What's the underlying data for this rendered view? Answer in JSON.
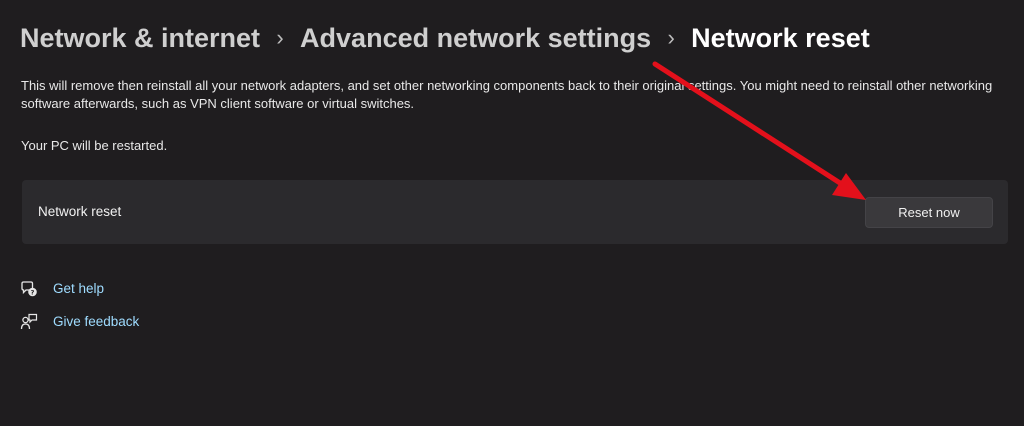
{
  "breadcrumb": {
    "items": [
      "Network & internet",
      "Advanced network settings",
      "Network reset"
    ],
    "separator_icon": "chevron-right-icon"
  },
  "description": "This will remove then reinstall all your network adapters, and set other networking components back to their original settings. You might need to reinstall other networking software afterwards, such as VPN client software or virtual switches.",
  "restart_note": "Your PC will be restarted.",
  "reset_card": {
    "label": "Network reset",
    "button_label": "Reset now"
  },
  "links": {
    "help_label": "Get help",
    "help_icon": "help-chat-icon",
    "feedback_label": "Give feedback",
    "feedback_icon": "feedback-icon"
  },
  "annotation": {
    "arrow_icon": "red-arrow-icon",
    "color": "#e3101b"
  },
  "colors": {
    "background": "#1f1d1f",
    "card": "#2b2a2d",
    "button": "#3a393c",
    "link": "#9fdcff"
  }
}
